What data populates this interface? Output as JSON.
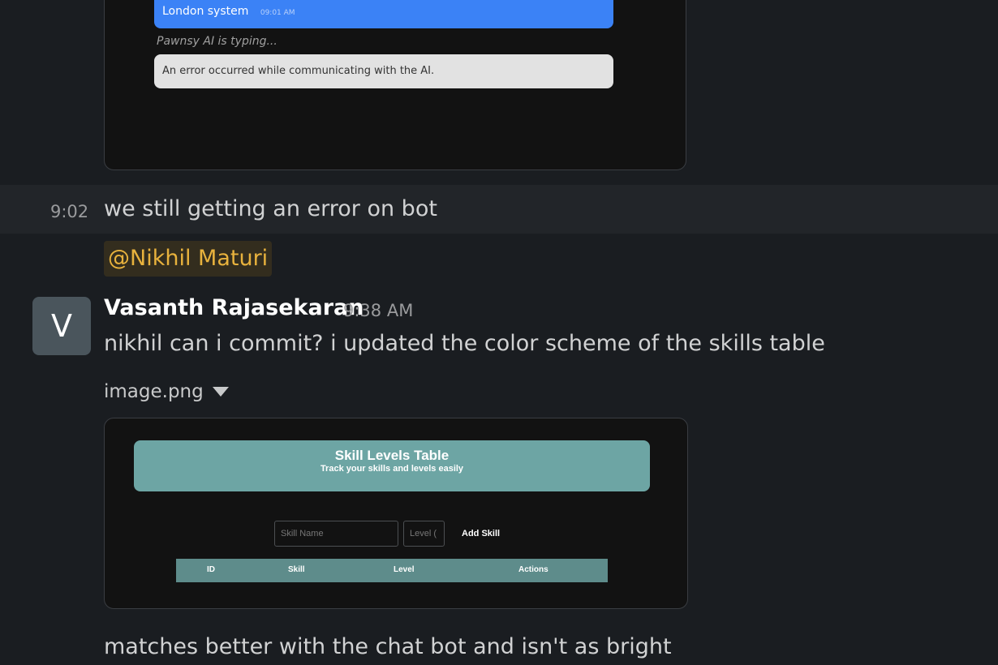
{
  "embed1": {
    "blue_bubble_text": "London system",
    "blue_bubble_time": "09:01 AM",
    "typing_text": "Pawnsy AI is typing...",
    "error_text": "An error occurred while communicating with the AI."
  },
  "messages": {
    "hover_time": "9:02",
    "msg1": "we still getting an error on bot",
    "mention": "@Nikhil Maturi",
    "avatar_letter": "V",
    "author": "Vasanth Rajasekaran",
    "author_time": "9:38 AM",
    "msg2": "nikhil can i commit? i updated the color scheme of the skills table",
    "file_name": "image.png",
    "msg3": "matches better with the chat bot and isn't as bright"
  },
  "embed2": {
    "title": "Skill Levels Table",
    "subtitle": "Track your skills and levels easily",
    "skill_placeholder": "Skill Name",
    "level_placeholder": "Level (",
    "add_button": "Add Skill",
    "columns": [
      "ID",
      "Skill",
      "Level",
      "Actions"
    ]
  },
  "colors": {
    "background": "#1a1d21",
    "mention_text": "#e8b23d",
    "blue_bubble": "#3b82f6",
    "teal_banner": "#6da5a4",
    "table_header": "#5e8c8b"
  }
}
